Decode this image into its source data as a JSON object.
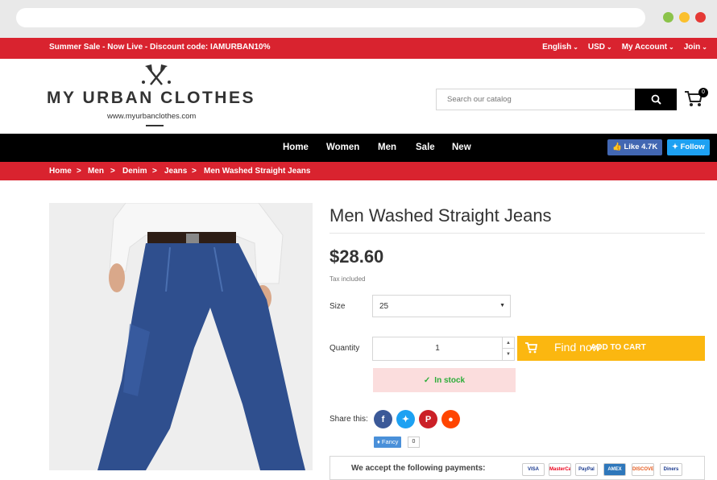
{
  "top_bar": {
    "promo": "Summer Sale - Now Live - Discount code: IAMURBAN10%",
    "links": [
      "English",
      "USD",
      "My Account",
      "Join"
    ]
  },
  "logo": {
    "name": "MY URBAN CLOTHES",
    "url": "www.myurbanclothes.com"
  },
  "search": {
    "placeholder": "Search our catalog"
  },
  "cart": {
    "count": "0"
  },
  "nav": {
    "items": [
      "Home",
      "Women",
      "Men",
      "Sale",
      "New"
    ]
  },
  "social": {
    "like": "Like 4.7K",
    "follow": "Follow"
  },
  "breadcrumb": [
    "Home",
    "Men",
    "Denim",
    "Jeans",
    "Men Washed Straight Jeans"
  ],
  "product": {
    "title": "Men Washed Straight Jeans",
    "price": "$28.60",
    "tax": "Tax included",
    "size_label": "Size",
    "size_value": "25",
    "quantity_label": "Quantity",
    "quantity_value": "1",
    "add_to_cart_overlay": "Find now",
    "add_to_cart": "ADD TO CART",
    "stock": "In stock",
    "share_label": "Share this:",
    "fancy": "Fancy",
    "fancy_count": "0",
    "payments_text": "We accept the following payments:",
    "payment_cards": [
      "VISA",
      "MasterCard",
      "PayPal",
      "AMEX",
      "DISCOVER",
      "Diners"
    ]
  },
  "colors": {
    "brand_red": "#d9232f",
    "nav_black": "#000000",
    "cart_button": "#fbb710",
    "stock_green": "#2cad39",
    "stock_bg": "#fbdddd",
    "facebook": "#3b5998",
    "twitter": "#1da1f2",
    "pinterest": "#cb2027",
    "reddit": "#ff4500"
  }
}
